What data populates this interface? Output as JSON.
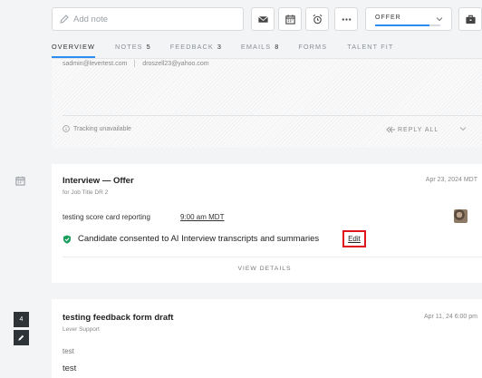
{
  "toolbar": {
    "note_placeholder": "Add note",
    "icons": [
      "email-icon",
      "calendar-icon",
      "alarm-icon",
      "more-icon"
    ],
    "stage_label": "OFFER",
    "briefcase_icon": "briefcase-icon"
  },
  "tabs": [
    {
      "label": "OVERVIEW",
      "count": ""
    },
    {
      "label": "NOTES",
      "count": "5"
    },
    {
      "label": "FEEDBACK",
      "count": "3"
    },
    {
      "label": "EMAILS",
      "count": "8"
    },
    {
      "label": "FORMS",
      "count": ""
    },
    {
      "label": "TALENT FIT",
      "count": ""
    }
  ],
  "email_card": {
    "from": "sadmin@levertest.com",
    "to": "droszell23@yahoo.com",
    "tracking": "Tracking unavailable",
    "reply_all": "REPLY ALL"
  },
  "interview_card": {
    "title": "Interview — Offer",
    "subtitle": "for Job Title DR 2",
    "date": "Apr 23, 2024 MDT",
    "row_name": "testing score card reporting",
    "row_time": "9:00 am MDT",
    "consent_text": "Candidate consented to AI Interview transcripts and summaries",
    "edit_label": "Edit",
    "view_details": "VIEW DETAILS"
  },
  "feedback_card": {
    "title": "testing feedback form draft",
    "subtitle": "Lever Support",
    "date": "Apr 11, 24 6:00 pm",
    "line1": "test",
    "line2": "test"
  },
  "side": {
    "count": "4"
  },
  "colors": {
    "accent": "#2d8cf0",
    "consent_check": "#1a9e5c",
    "highlight": "#e0151b",
    "dark_badge": "#2e3338"
  }
}
